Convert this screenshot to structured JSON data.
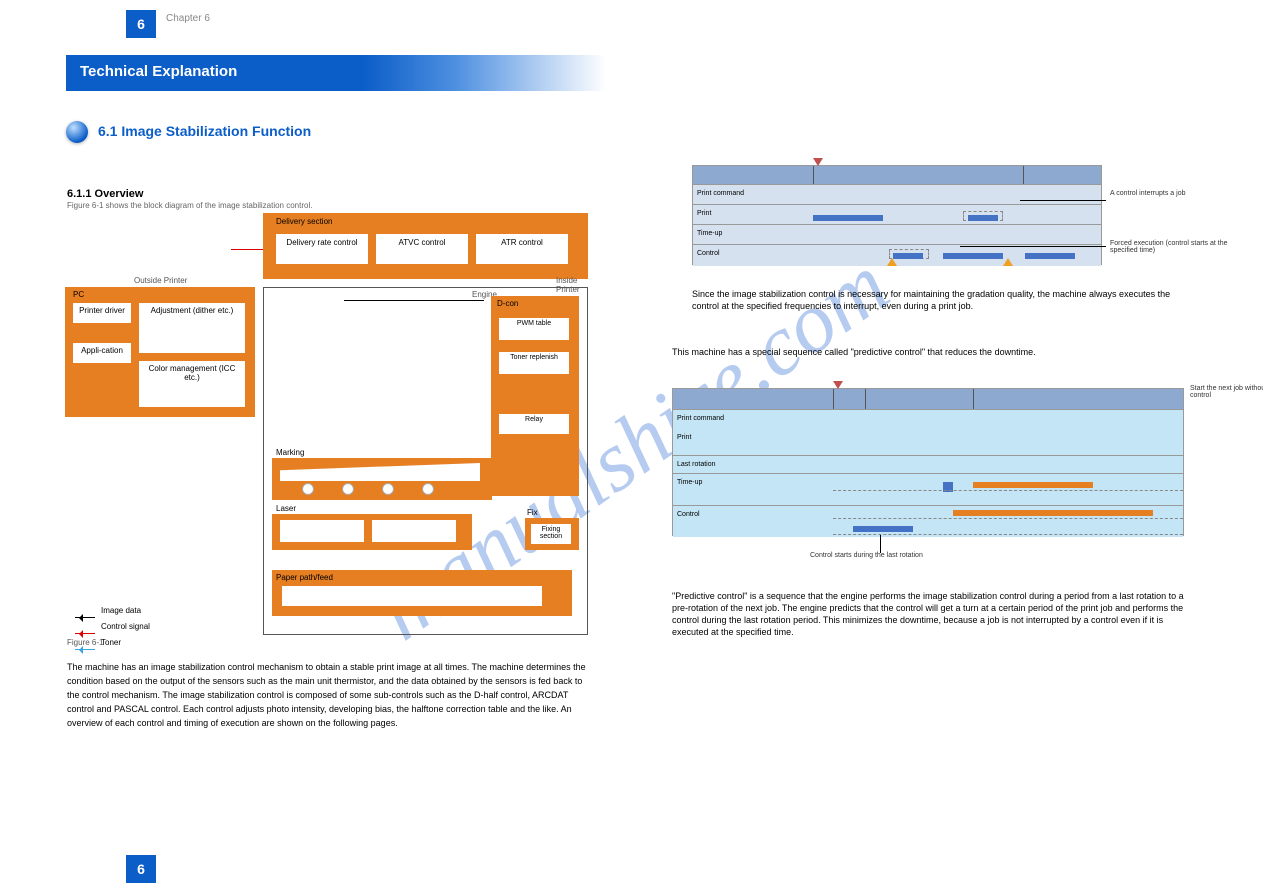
{
  "page": {
    "number": "6",
    "chapter": "Chapter 6"
  },
  "title_bar": "Technical Explanation",
  "subtitle": "6.1 Image Stabilization Function",
  "watermark": "manualshive.com",
  "left": {
    "heading1": "6.1.1 Overview",
    "heading2": "Figure 6-1 shows the block diagram of the image stabilization control.",
    "fig1_label": "Figure 6-1",
    "outside_label": "Outside Printer",
    "toplabel": "Delivery section",
    "top_boxes": {
      "b1": "Delivery rate control",
      "b2": "ATVC control",
      "b3": "ATR control"
    },
    "pclabel": "PC",
    "pc_boxes": {
      "b1": "Printer driver",
      "b2": "Appli-cation",
      "b3": "Adjustment (dither etc.)",
      "b4": "Color management (ICC etc.)"
    },
    "engine_label": "Engine",
    "eng_col_label": "Inside Printer",
    "cg_dcon_label": "D-con",
    "dcon": {
      "w1": "PWM table",
      "w2": "Toner replenish",
      "w3": "Relay"
    },
    "marker": {
      "label": "Marking"
    },
    "laser": {
      "label": "Laser"
    },
    "fix": {
      "label": "Fix",
      "box": "Fixing section"
    },
    "paper": {
      "label": "Paper path/feed"
    },
    "legend": {
      "black": "Image data",
      "red": "Control signal",
      "blue": "Toner"
    },
    "paragraph": "The machine has an image stabilization control mechanism to obtain a stable print image at all times. The machine determines the condition based on the output of the sensors such as the main unit thermistor, and the data obtained by the sensors is fed back to the control mechanism. The image stabilization control is composed of some sub-controls such as the D-half control, ARCDAT control and PASCAL control. Each control adjusts photo intensity, developing bias, the halftone correction table and the like. An overview of each control and timing of execution are shown on the following pages."
  },
  "right": {
    "fig1": {
      "headers": [
        "",
        "",
        ""
      ],
      "rows": [
        "Print command",
        "Print",
        "Time-up",
        "Control"
      ],
      "callouts": {
        "c1": "A control interrupts a job",
        "c2": "Forced execution (control starts at the specified time)"
      },
      "caption": "Since the image stabilization control is necessary for maintaining the gradation quality, the machine always executes the control at the specified frequencies to interrupt, even during a print job."
    },
    "midpara": "This machine has a special sequence called \"predictive control\" that reduces the downtime.",
    "fig2": {
      "rows": [
        "Print command",
        "Print",
        "Time-up",
        "Control"
      ],
      "mid_label": "Last rotation",
      "callouts": {
        "c1": "Control starts during the last rotation",
        "c2": "Start the next job without control"
      },
      "caption": "\"Predictive control\" is a sequence that the engine performs the image stabilization control during a period from a last rotation to a pre-rotation of the next job. The engine predicts that the control will get a turn at a certain period of the print job and performs the control during the last rotation period. This minimizes the downtime, because a job is not interrupted by a control even if it is executed at the specified time."
    }
  }
}
